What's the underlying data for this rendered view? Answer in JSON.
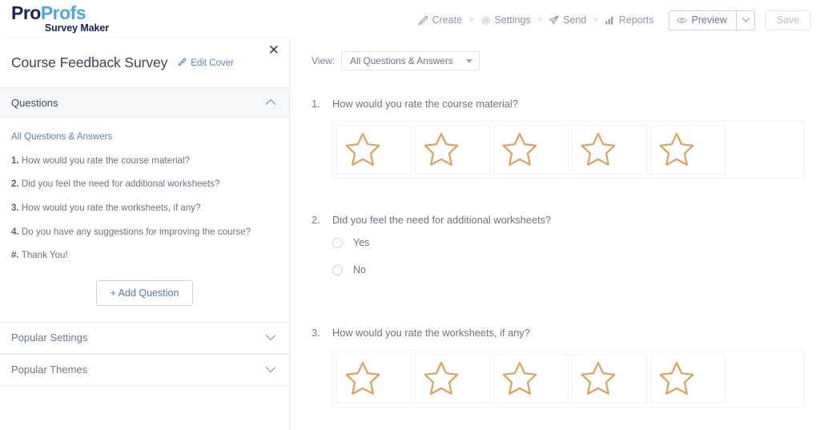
{
  "brand": {
    "name_part1": "Pro",
    "name_part2": "Profs",
    "product": "Survey Maker",
    "color_dark": "#1b1f5e",
    "color_light": "#4aa8e0"
  },
  "topnav": {
    "links": [
      {
        "label": "Create",
        "icon": "pencil-icon"
      },
      {
        "label": "Settings",
        "icon": "gear-icon"
      },
      {
        "label": "Send",
        "icon": "paper-plane-icon"
      },
      {
        "label": "Reports",
        "icon": "bar-chart-icon"
      }
    ],
    "separator": ">",
    "preview_label": "Preview",
    "preview_icon": "eye-icon",
    "preview_caret_icon": "chevron-down-icon",
    "save_label": "Save"
  },
  "sidebar": {
    "survey_title": "Course Feedback Survey",
    "edit_cover_label": "Edit Cover",
    "edit_cover_icon": "pencil-icon",
    "close_icon": "close-icon",
    "questions_section": {
      "label": "Questions",
      "chevron_icon": "chevron-up-icon",
      "all_label": "All Questions & Answers",
      "items": [
        {
          "num": "1.",
          "text": "How would you rate the course material?"
        },
        {
          "num": "2.",
          "text": "Did you feel the need for additional worksheets?"
        },
        {
          "num": "3.",
          "text": "How would you rate the worksheets, if any?"
        },
        {
          "num": "4.",
          "text": "Do you have any suggestions for improving the course?"
        },
        {
          "num": "#.",
          "text": "Thank You!"
        }
      ],
      "add_question_label": "+ Add Question"
    },
    "popular_settings": {
      "label": "Popular Settings",
      "chevron_icon": "chevron-down-icon"
    },
    "popular_themes": {
      "label": "Popular Themes",
      "chevron_icon": "chevron-down-icon"
    }
  },
  "main": {
    "view_label": "View:",
    "view_selected": "All Questions & Answers",
    "view_caret_icon": "chevron-down-icon",
    "star_color": "#dda15e",
    "questions": [
      {
        "number": "1.",
        "text": "How would you rate the course material?",
        "type": "star-rating",
        "star_count": 5,
        "star_icon": "star-outline-icon"
      },
      {
        "number": "2.",
        "text": "Did you feel the need for additional worksheets?",
        "type": "radio",
        "options": [
          "Yes",
          "No"
        ]
      },
      {
        "number": "3.",
        "text": "How would you rate the worksheets, if any?",
        "type": "star-rating",
        "star_count": 5,
        "star_icon": "star-outline-icon"
      }
    ]
  }
}
